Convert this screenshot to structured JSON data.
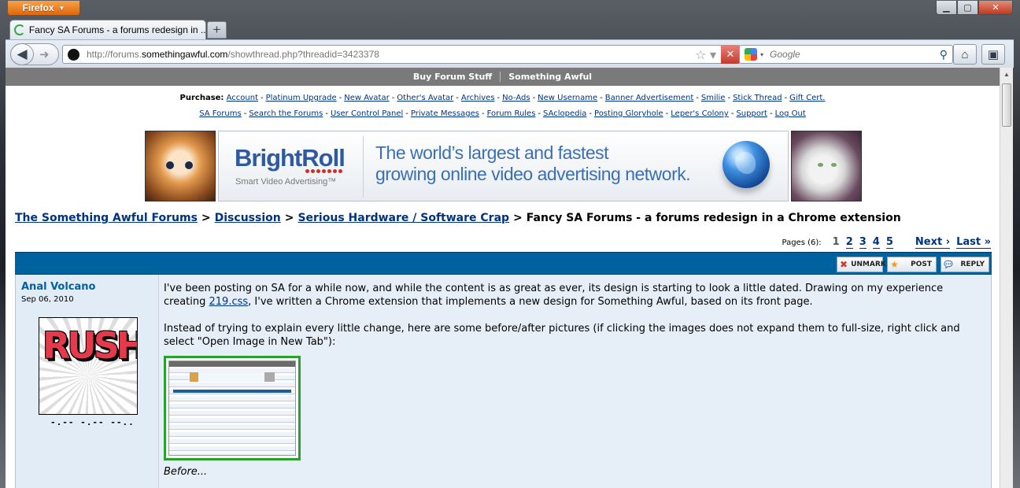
{
  "browser": {
    "menu_label": "Firefox",
    "tab_title": "Fancy SA Forums - a forums redesign in ...",
    "new_tab": "+",
    "url_prefix": "http://forums.",
    "url_domain": "somethingawful.com",
    "url_path": "/showthread.php?threadid=3423378",
    "search_placeholder": "Google",
    "window_controls": [
      "minimize-icon",
      "maximize-icon",
      "close-icon"
    ]
  },
  "site": {
    "topbar": [
      "Buy Forum Stuff",
      "Something Awful"
    ],
    "purchase_label": "Purchase:",
    "purchase_links": [
      "Account",
      "Platinum Upgrade",
      "New Avatar",
      "Other's Avatar",
      "Archives",
      "No-Ads",
      "New Username",
      "Banner Advertisement",
      "Smilie",
      "Stick Thread",
      "Gift Cert."
    ],
    "nav_links": [
      "SA Forums",
      "Search the Forums",
      "User Control Panel",
      "Private Messages",
      "Forum Rules",
      "SAclopedia",
      "Posting Gloryhole",
      "Leper's Colony",
      "Support",
      "Log Out"
    ]
  },
  "ad": {
    "brand": "BrightRoll",
    "tagline": "Smart Video Advertising™",
    "line1": "The world’s largest and fastest",
    "line2": "growing online video advertising network."
  },
  "breadcrumb": {
    "items": [
      "The Something Awful Forums",
      "Discussion",
      "Serious Hardware / Software Crap"
    ],
    "current": "Fancy SA Forums - a forums redesign in a Chrome extension",
    "separator": ">"
  },
  "pagination": {
    "label": "Pages (6):",
    "current": "1",
    "pages": [
      "2",
      "3",
      "4",
      "5"
    ],
    "next": "Next ›",
    "last": "Last »"
  },
  "post_actions": {
    "unmark": "UNMARK",
    "post": "POST",
    "reply": "REPLY"
  },
  "post": {
    "author": "Anal Volcano",
    "reg_date": "Sep 06, 2010",
    "avatar_text": "RUSH",
    "user_title": "-.-- -.-- --..",
    "para1_a": "I've been posting on SA for a while now, and while the content is as great as ever, its design is starting to look a little dated. Drawing on my experience creating ",
    "para1_link": "219.css",
    "para1_b": ", I've written a Chrome extension that implements a new design for Something Awful, based on its front page.",
    "para2": "Instead of trying to explain every little change, here are some before/after pictures (if clicking the images does not expand them to full-size, right click and select \"Open Image in New Tab\"):",
    "caption": "Before..."
  },
  "colors": {
    "post_bar": "#00619f",
    "link": "#00337f",
    "userinfo_bg": "#e1ecf6",
    "postbody_bg": "#e6eef7",
    "firefox_orange": "#e0670c"
  }
}
